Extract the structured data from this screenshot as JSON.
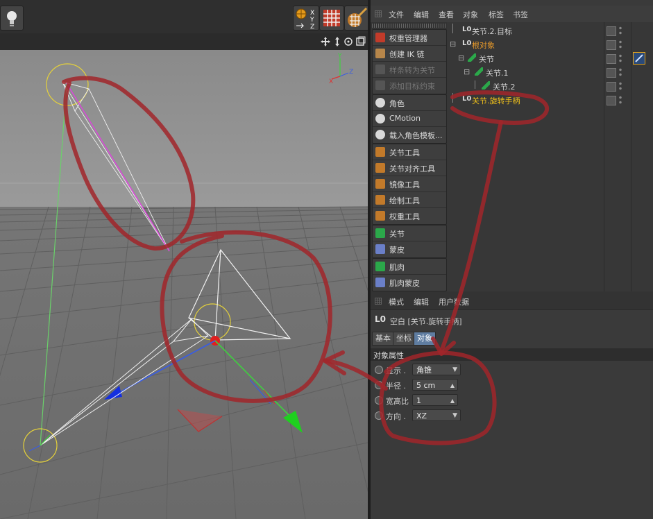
{
  "menubar": {
    "items": [
      "文件",
      "编辑",
      "查看",
      "对象",
      "标签",
      "书签"
    ]
  },
  "tools": {
    "group1": [
      "权重管理器",
      "创建 IK 链",
      "样条转为关节",
      "添加目标约束"
    ],
    "group2": [
      "角色",
      "CMotion",
      "载入角色模板..."
    ],
    "group3": [
      "关节工具",
      "关节对齐工具",
      "镜像工具",
      "绘制工具",
      "权重工具"
    ],
    "group4": [
      "关节",
      "蒙皮"
    ],
    "group5": [
      "肌肉",
      "肌肉蒙皮"
    ]
  },
  "objects": [
    {
      "label": "关节.2.目标",
      "color": "#cfcfcf",
      "indent": 0
    },
    {
      "label": "根对象",
      "color": "#e89a2a",
      "indent": 0
    },
    {
      "label": "关节",
      "color": "#cfcfcf",
      "indent": 1
    },
    {
      "label": "关节.1",
      "color": "#cfcfcf",
      "indent": 2
    },
    {
      "label": "关节.2",
      "color": "#cfcfcf",
      "indent": 3
    },
    {
      "label": "关节.旋转手柄",
      "color": "#f2c21a",
      "indent": 0
    }
  ],
  "attributes": {
    "header_items": [
      "模式",
      "编辑",
      "用户数据"
    ],
    "object_title": "空白 [关节.旋转手柄]",
    "tabs": [
      "基本",
      "坐标",
      "对象"
    ],
    "active_tab": "对象",
    "section": "对象属性",
    "properties": [
      {
        "label": "显示 .",
        "value": "角锥",
        "kind": "dropdown"
      },
      {
        "label": "半径 .",
        "value": "5 cm",
        "kind": "spinner"
      },
      {
        "label": "宽高比",
        "value": "1",
        "kind": "spinner"
      },
      {
        "label": "方向 .",
        "value": "XZ",
        "kind": "dropdown"
      }
    ]
  },
  "axis_labels": {
    "y": "Y",
    "x": "X",
    "z": "Z"
  },
  "toolbar_axes": {
    "x": "X",
    "y": "Y",
    "z": "Z"
  },
  "colors": {
    "selected_tab": "#5f7da1",
    "root_object": "#e89a2a",
    "handle_object": "#f2c21a",
    "annotation": "#a1262a"
  }
}
